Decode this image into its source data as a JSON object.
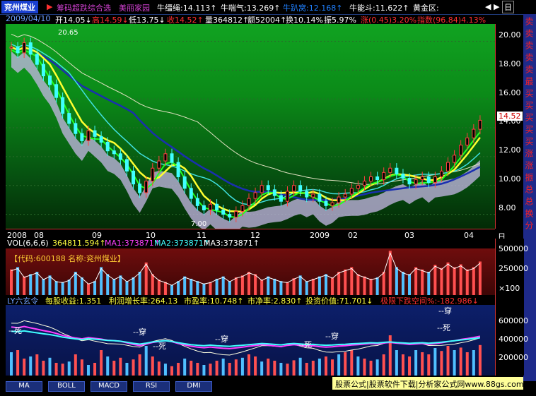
{
  "titlebar": {
    "stock_name": "兖州煤业",
    "items": [
      {
        "text": "▶",
        "color": "#ff3030"
      },
      {
        "text": "筹码超跌综合选",
        "color": "#d040d0"
      },
      {
        "text": "美丽家园",
        "color": "#d040d0"
      },
      {
        "text": "牛缰绳:14.113↑",
        "color": "#ffffff"
      },
      {
        "text": "牛喘气:13.269↑",
        "color": "#ffffff"
      },
      {
        "text": "牛趴窝:12.168↑",
        "color": "#2080ff"
      },
      {
        "text": "牛能斗:11.622↑",
        "color": "#ffffff"
      },
      {
        "text": "黄金区:",
        "color": "#ffffff"
      }
    ],
    "controls": [
      "◀",
      "▶",
      "日"
    ]
  },
  "infobar": {
    "date": "2009/04/10",
    "open": "开14.05↓",
    "high": "高14.59↓",
    "low": "低13.75↓",
    "close": "收14.52↑",
    "volume": "量364812↑",
    "amount": "额52004↑",
    "turnover": "换10.14%",
    "amplitude": "振5.97%",
    "change": "涨(0.45)3.20%",
    "index": "指数(96.84)4.13%"
  },
  "chart_data": {
    "type": "candlestick",
    "price_axis": {
      "ticks": [
        "20.00",
        "18.00",
        "16.00",
        "14.00",
        "12.00",
        "10.00",
        "8.00"
      ],
      "ylim": [
        7.0,
        21.2
      ]
    },
    "high_label": "20.65",
    "low_label": "7.00",
    "current_price": "14.52",
    "time_labels": [
      "2008",
      "08",
      "09",
      "10",
      "11",
      "12",
      "2009",
      "02",
      "03",
      "04"
    ],
    "period_button": "日线",
    "close_series": [
      19.6,
      19.2,
      19.9,
      19.1,
      18.4,
      17.6,
      17.0,
      16.1,
      15.0,
      14.3,
      13.6,
      13.1,
      13.8,
      13.4,
      13.0,
      12.4,
      12.2,
      11.8,
      11.0,
      10.1,
      9.5,
      10.3,
      11.2,
      11.7,
      12.2,
      11.6,
      10.6,
      9.8,
      9.1,
      8.6,
      8.3,
      8.7,
      8.3,
      8.0,
      7.8,
      8.2,
      8.6,
      9.1,
      9.5,
      10.0,
      9.7,
      9.3,
      8.9,
      9.6,
      10.0,
      9.6,
      9.2,
      9.4,
      8.9,
      8.6,
      8.8,
      9.2,
      9.4,
      9.8,
      10.0,
      10.3,
      10.6,
      10.4,
      10.9,
      11.2,
      10.8,
      10.5,
      10.1,
      10.4,
      10.6,
      10.2,
      10.6,
      11.0,
      11.6,
      12.1,
      12.8,
      13.3,
      13.9,
      14.52
    ]
  },
  "volume_panel": {
    "title": "VOL(6,6,6)",
    "vol": "364811.594↑",
    "ma1": "MA1:373871↑",
    "ma2": "MA2:373871↑",
    "ma3": "MA3:373871↑",
    "code_label": "【代码:600188 名称:兖州煤业】",
    "axis_ticks": [
      "500000",
      "250000",
      "×100"
    ],
    "bars": [
      0.55,
      0.6,
      0.4,
      0.45,
      0.5,
      0.35,
      0.42,
      0.3,
      0.28,
      0.33,
      0.5,
      0.38,
      0.25,
      0.3,
      0.6,
      0.45,
      0.35,
      0.42,
      0.3,
      0.38,
      0.5,
      0.7,
      0.45,
      0.33,
      0.28,
      0.22,
      0.3,
      0.4,
      0.35,
      0.3,
      0.25,
      0.28,
      0.35,
      0.4,
      0.3,
      0.38,
      0.42,
      0.5,
      0.45,
      0.33,
      0.4,
      0.35,
      0.3,
      0.28,
      0.36,
      0.42,
      0.3,
      0.35,
      0.4,
      0.45,
      0.38,
      0.5,
      0.55,
      0.6,
      0.45,
      0.4,
      0.35,
      0.38,
      0.5,
      0.95,
      0.6,
      0.5,
      0.45,
      0.6,
      0.55,
      0.5,
      0.65,
      0.58,
      0.7,
      0.6,
      0.66,
      0.55,
      0.6,
      0.72
    ]
  },
  "ly_panel": {
    "title": "LY六玄令",
    "eps": "每股收益:1.351",
    "profit_growth": "利润增长率:264.13",
    "pe": "市盈率:10.748↑",
    "pb": "市净率:2.830↑",
    "invest_value": "投资价值:71.701↓",
    "limit_down": "极限下跌空间%:-182.986↓",
    "axis_ticks": [
      "600000",
      "400000",
      "200000"
    ],
    "annotations": [
      "--死",
      "--穿",
      "--死",
      "--穿",
      "--死",
      "--穿",
      "--死",
      "--穿"
    ]
  },
  "bottom_tabs": [
    "MA",
    "BOLL",
    "MACD",
    "RSI",
    "DMI"
  ],
  "sidebar": [
    "卖",
    "卖",
    "卖",
    "卖",
    "卖",
    "最",
    "买",
    "买",
    "买",
    "买",
    "买",
    "涨",
    "涨",
    "振",
    "总",
    "总",
    "换",
    "分"
  ],
  "ad_text": "股票公式|股票软件下载|分析家公式网www.88gs.com"
}
